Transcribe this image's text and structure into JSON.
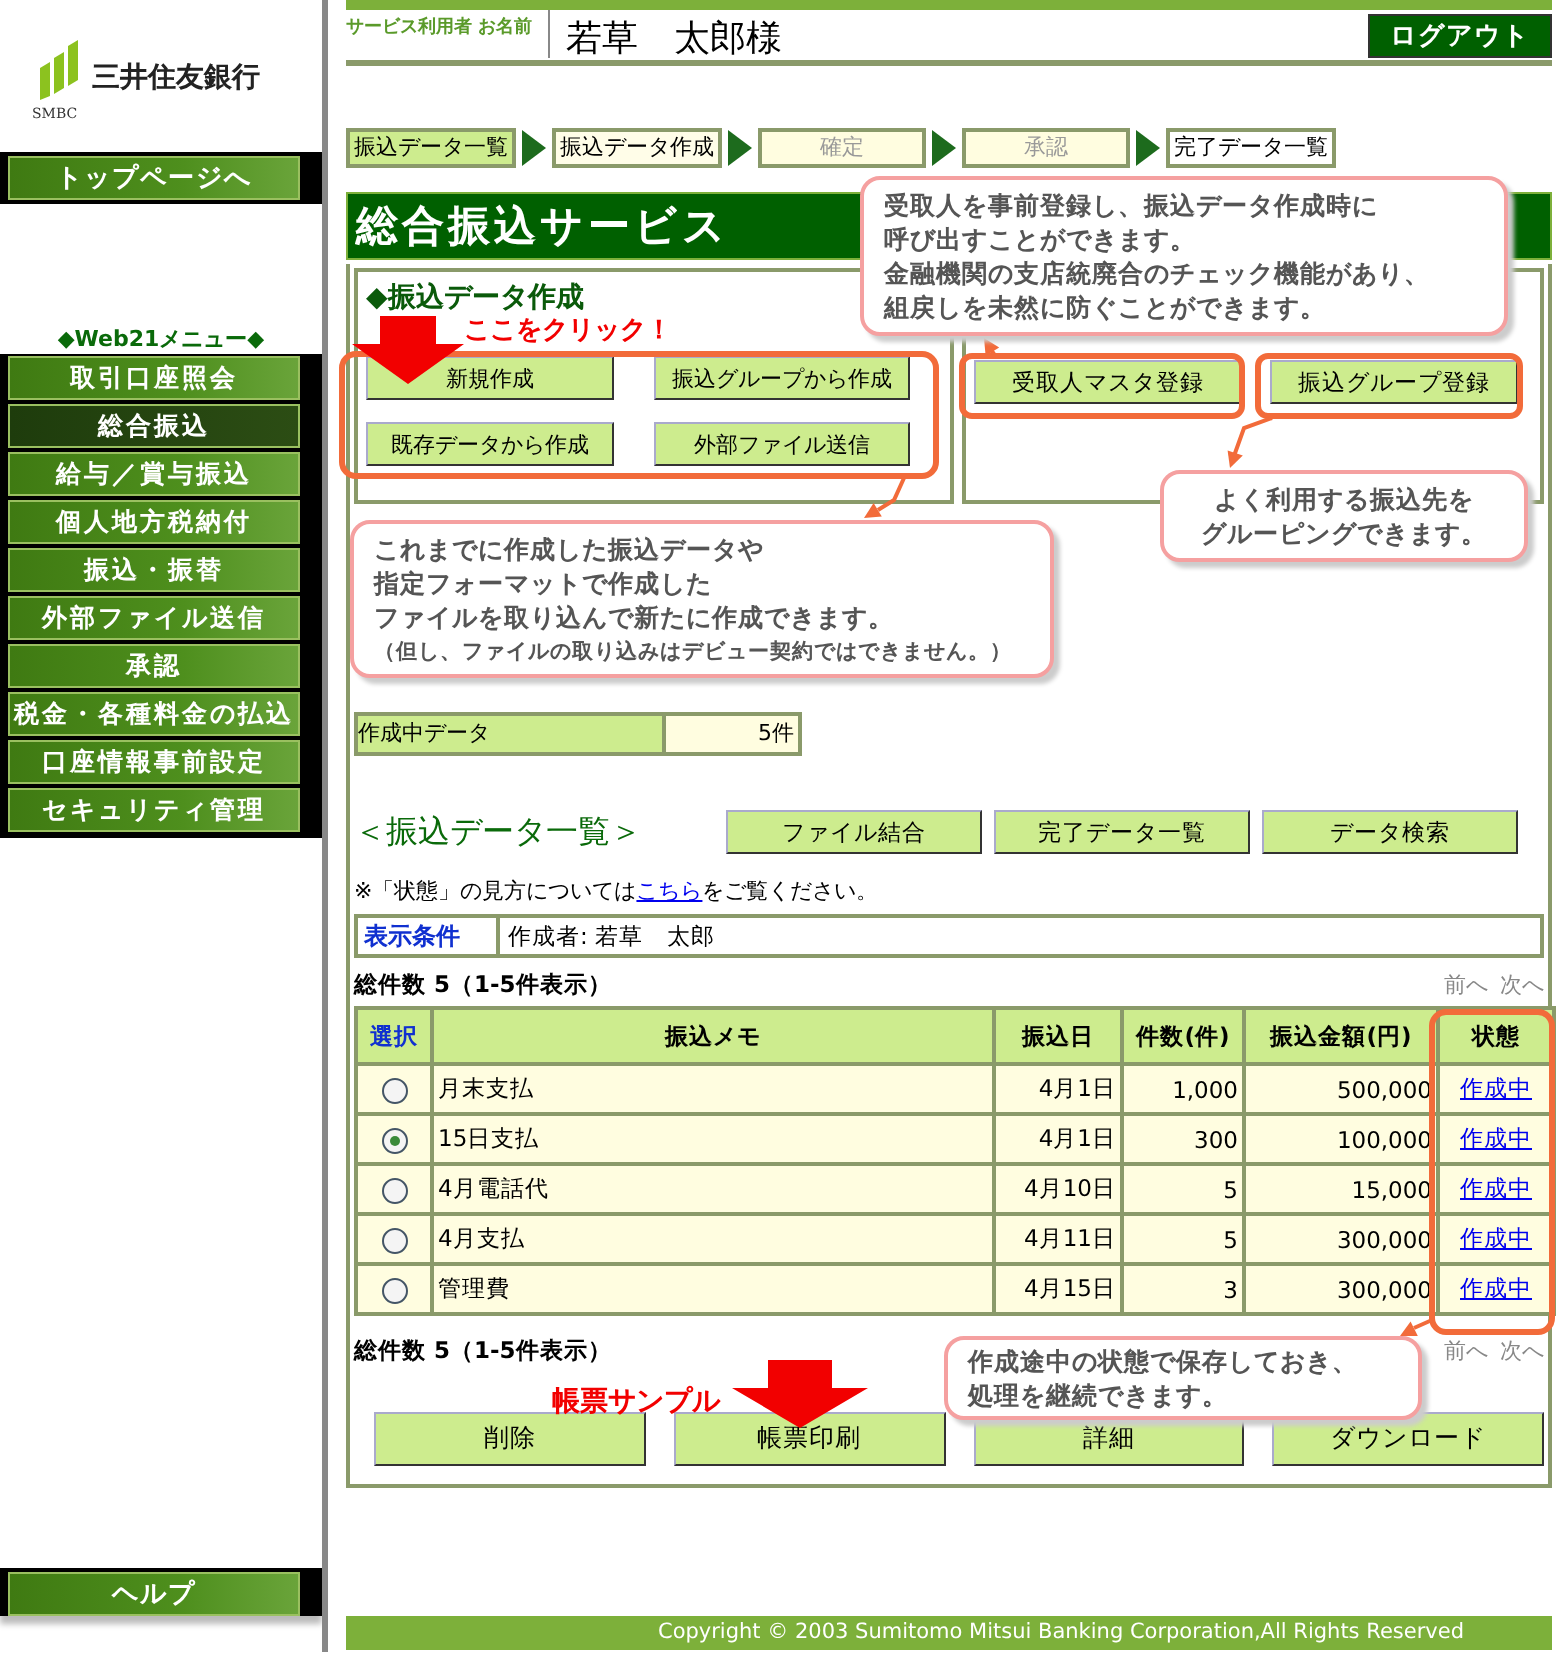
{
  "logo": {
    "name": "三井住友銀行",
    "mark": "SMBC"
  },
  "sidebar": {
    "top_button": "トップページへ",
    "menu_title": "◆Web21メニュー◆",
    "items": [
      {
        "label": "取引口座照会",
        "selected": false
      },
      {
        "label": "総合振込",
        "selected": true
      },
      {
        "label": "給与／賞与振込",
        "selected": false
      },
      {
        "label": "個人地方税納付",
        "selected": false
      },
      {
        "label": "振込・振替",
        "selected": false
      },
      {
        "label": "外部ファイル送信",
        "selected": false
      },
      {
        "label": "承認",
        "selected": false
      },
      {
        "label": "税金・各種料金の払込",
        "selected": false
      },
      {
        "label": "口座情報事前設定",
        "selected": false
      },
      {
        "label": "セキュリティ管理",
        "selected": false
      }
    ],
    "help": "ヘルプ"
  },
  "header": {
    "user_label": "サービス利用者 お名前",
    "user_name": "若草　太郎様",
    "logout": "ログアウト"
  },
  "steps": [
    {
      "label": "振込データ一覧",
      "kind": "link"
    },
    {
      "label": "振込データ作成",
      "kind": "current"
    },
    {
      "label": "確定",
      "kind": "disabled"
    },
    {
      "label": "承認",
      "kind": "disabled"
    },
    {
      "label": "完了データ一覧",
      "kind": "plain"
    }
  ],
  "title": "総合振込サービス",
  "create_panel": {
    "heading": "◆振込データ作成",
    "buttons": [
      "新規作成",
      "振込グループから作成",
      "既存データから作成",
      "外部ファイル送信"
    ]
  },
  "master_panel": {
    "buttons": [
      "受取人マスタ登録",
      "振込グループ登録"
    ]
  },
  "summary": [
    {
      "label": "作成中データ",
      "value": "5件"
    }
  ],
  "list": {
    "heading": "＜振込データ一覧＞",
    "buttons": [
      "ファイル結合",
      "完了データ一覧",
      "データ検索"
    ],
    "note": {
      "before": "※「状態」の見方については",
      "link": "こちら",
      "after": "をご覧ください。"
    },
    "condition": {
      "label": "表示条件",
      "value": "作成者: 若草　太郎"
    },
    "total_top": "総件数 5（1-5件表示）",
    "pager_top": [
      "前へ",
      "次へ"
    ],
    "columns": [
      "選択",
      "振込メモ",
      "振込日",
      "件数(件)",
      "振込金額(円)",
      "状態"
    ],
    "rows": [
      {
        "selected": false,
        "memo": "月末支払",
        "date": "4月1日",
        "count": "1,000",
        "amount": "500,000",
        "status": "作成中"
      },
      {
        "selected": true,
        "memo": "15日支払",
        "date": "4月1日",
        "count": "300",
        "amount": "100,000",
        "status": "作成中"
      },
      {
        "selected": false,
        "memo": "4月電話代",
        "date": "4月10日",
        "count": "5",
        "amount": "15,000",
        "status": "作成中"
      },
      {
        "selected": false,
        "memo": "4月支払",
        "date": "4月11日",
        "count": "5",
        "amount": "300,000",
        "status": "作成中"
      },
      {
        "selected": false,
        "memo": "管理費",
        "date": "4月15日",
        "count": "3",
        "amount": "300,000",
        "status": "作成中"
      }
    ],
    "total_bottom": "総件数 5（1-5件表示）",
    "pager_bottom": [
      "前へ",
      "次へ"
    ],
    "actions": [
      "削除",
      "帳票印刷",
      "詳細",
      "ダウンロード"
    ]
  },
  "footer": "Copyright © 2003 Sumitomo Mitsui Banking Corporation,All Rights Reserved",
  "annotations": {
    "click_label": "ここをクリック！",
    "sample_label": "帳票サンプル",
    "callouts": [
      {
        "lines": [
          "受取人を事前登録し、振込データ作成時に",
          "呼び出すことができます。",
          "金融機関の支店統廃合のチェック機能があり、",
          "組戻しを未然に防ぐことができます。"
        ]
      },
      {
        "lines": [
          "よく利用する振込先を",
          "グルーピングできます。"
        ]
      },
      {
        "lines": [
          "これまでに作成した振込データや",
          "指定フォーマットで作成した",
          "ファイルを取り込んで新たに作成できます。"
        ],
        "note": "（但し、ファイルの取り込みはデビュー契約ではできません。）"
      },
      {
        "lines": [
          "作成途中の状態で保存しておき、",
          "処理を継続できます。"
        ]
      }
    ]
  }
}
